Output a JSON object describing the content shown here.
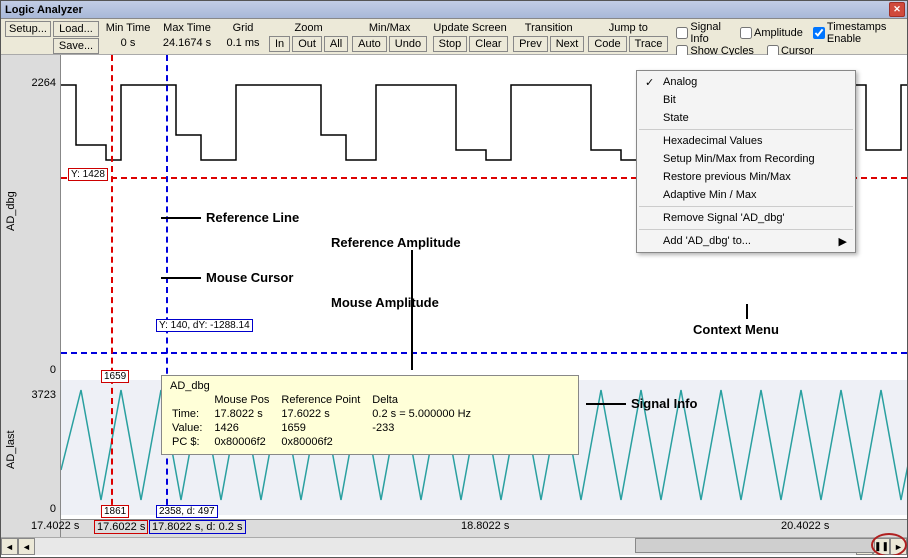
{
  "title": "Logic Analyzer",
  "toolbar": {
    "setup": "Setup...",
    "load": "Load...",
    "save": "Save...",
    "min_time_label": "Min Time",
    "min_time_value": "0 s",
    "max_time_label": "Max Time",
    "max_time_value": "24.1674 s",
    "grid_label": "Grid",
    "grid_value": "0.1 ms",
    "zoom_label": "Zoom",
    "zoom_in": "In",
    "zoom_out": "Out",
    "zoom_all": "All",
    "minmax_label": "Min/Max",
    "minmax_auto": "Auto",
    "minmax_undo": "Undo",
    "update_label": "Update Screen",
    "update_stop": "Stop",
    "update_clear": "Clear",
    "transition_label": "Transition",
    "transition_prev": "Prev",
    "transition_next": "Next",
    "jump_label": "Jump to",
    "jump_code": "Code",
    "jump_trace": "Trace",
    "check_signal_info": "Signal Info",
    "check_show_cycles": "Show Cycles",
    "check_amplitude": "Amplitude",
    "check_cursor": "Cursor",
    "check_timestamps": "Timestamps Enable"
  },
  "signals": {
    "sig1": {
      "name": "AD_dbg",
      "ymax": "2264",
      "ymin": "0"
    },
    "sig2": {
      "name": "AD_last",
      "ymax": "3723",
      "ymin": "0"
    }
  },
  "markers": {
    "y_red": "Y: 1428",
    "y_blue": "Y: 140, dY: -1288.14",
    "x_red_top": "1659",
    "x_red_bot": "1861",
    "x_blue_bot": "2358, d: 497"
  },
  "annotations": {
    "ref_line": "Reference Line",
    "ref_amp": "Reference Amplitude",
    "mouse_cursor": "Mouse Cursor",
    "mouse_amp": "Mouse Amplitude",
    "ctx_menu": "Context Menu",
    "signal_info": "Signal Info"
  },
  "infobox": {
    "title": "AD_dbg",
    "cols": [
      "",
      "Mouse Pos",
      "Reference Point",
      "Delta"
    ],
    "rows": [
      [
        "Time:",
        "17.8022 s",
        "17.6022 s",
        "0.2 s = 5.000000 Hz"
      ],
      [
        "Value:",
        "1426",
        "1659",
        "-233"
      ],
      [
        "PC $:",
        "0x80006f2",
        "0x80006f2",
        ""
      ]
    ]
  },
  "context_menu": {
    "items": [
      {
        "label": "Analog",
        "checked": true
      },
      {
        "label": "Bit"
      },
      {
        "label": "State"
      },
      {
        "sep": true
      },
      {
        "label": "Hexadecimal Values"
      },
      {
        "label": "Setup Min/Max from Recording"
      },
      {
        "label": "Restore previous Min/Max"
      },
      {
        "label": "Adaptive Min / Max"
      },
      {
        "sep": true
      },
      {
        "label": "Remove Signal 'AD_dbg'"
      },
      {
        "sep": true
      },
      {
        "label": "Add 'AD_dbg' to...",
        "arrow": true
      }
    ]
  },
  "xaxis": {
    "v1": "17.4022 s",
    "v2": "17.6022 s",
    "v3": "17.8022 s, d: 0.2 s",
    "v4": "18.8022 s",
    "v5": "20.4022 s"
  },
  "chart_data": {
    "type": "line",
    "signals": [
      {
        "name": "AD_dbg",
        "ylim": [
          0,
          2264
        ],
        "color": "#000000",
        "style": "step-square-wave",
        "ref_y": 1428,
        "mouse_y": 140,
        "delta_y": -1288.14,
        "ref_x_s": 17.6022,
        "mouse_x_s": 17.8022,
        "delta_x_s": 0.2,
        "ref_value": 1659,
        "mouse_value": 1426,
        "pc_ref": "0x80006f2",
        "pc_mouse": "0x80006f2"
      },
      {
        "name": "AD_last",
        "ylim": [
          0,
          3723
        ],
        "color": "#2aa0a0",
        "style": "sawtooth",
        "ref_value": 1861,
        "mouse_value": 2358,
        "delta_value": 497
      }
    ],
    "x_range_s": [
      17.4022,
      20.4022
    ],
    "min_time_s": 0,
    "max_time_s": 24.1674,
    "grid_s": 0.0001
  }
}
